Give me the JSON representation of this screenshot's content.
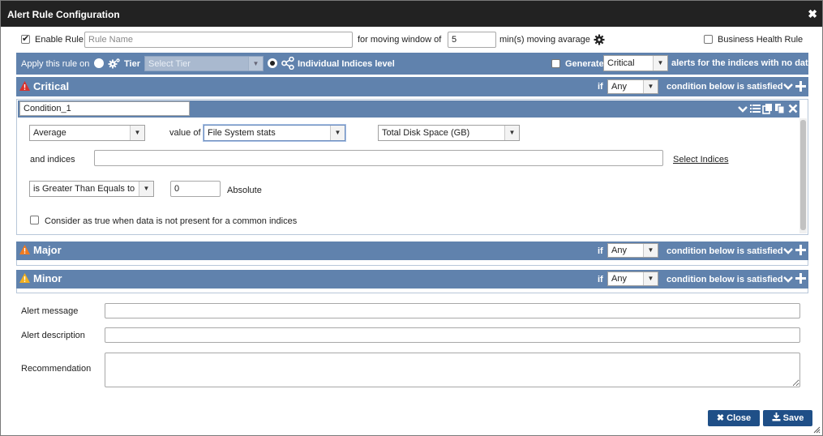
{
  "dialog": {
    "title": "Alert Rule Configuration",
    "close_glyph": "✖"
  },
  "top": {
    "enable_rule_label": "Enable Rule",
    "rule_name_placeholder": "Rule Name",
    "moving_window_label": "for moving window of",
    "moving_window_value": "5",
    "moving_average_label": "min(s) moving avarage",
    "business_health_label": "Business Health Rule"
  },
  "apply_bar": {
    "apply_label": "Apply this rule on",
    "tier_label": "Tier",
    "tier_placeholder": "Select Tier",
    "indices_label": "Individual Indices level",
    "generate_label": "Generate",
    "generate_value": "Critical",
    "no_data_label": "alerts for the indices with no data"
  },
  "severities": [
    {
      "name": "Critical",
      "if_label": "if",
      "match_value": "Any",
      "condition_label": "condition below is satisfied",
      "color": "#d9302a"
    },
    {
      "name": "Major",
      "if_label": "if",
      "match_value": "Any",
      "condition_label": "condition below is satisfied",
      "color": "#f07a1e"
    },
    {
      "name": "Minor",
      "if_label": "if",
      "match_value": "Any",
      "condition_label": "condition below is satisfied",
      "color": "#f2b01e"
    }
  ],
  "condition": {
    "name_value": "Condition_1",
    "aggregate_value": "Average",
    "value_of_label": "value of",
    "group_value": "File System stats",
    "metric_value": "Total Disk Space (GB)",
    "indices_label": "and indices",
    "indices_value": "",
    "select_indices_label": "Select Indices",
    "operator_value": "is Greater Than Equals to",
    "threshold_value": "0",
    "threshold_type_label": "Absolute",
    "consider_label": "Consider as true when data is not present for a common indices"
  },
  "fields": {
    "alert_message_label": "Alert message",
    "alert_description_label": "Alert description",
    "recommendation_label": "Recommendation"
  },
  "buttons": {
    "close_label": "Close",
    "save_label": "Save"
  },
  "colors": {
    "header_bar": "#6082ad",
    "title_bar": "#222222",
    "button": "#1f4f87"
  }
}
